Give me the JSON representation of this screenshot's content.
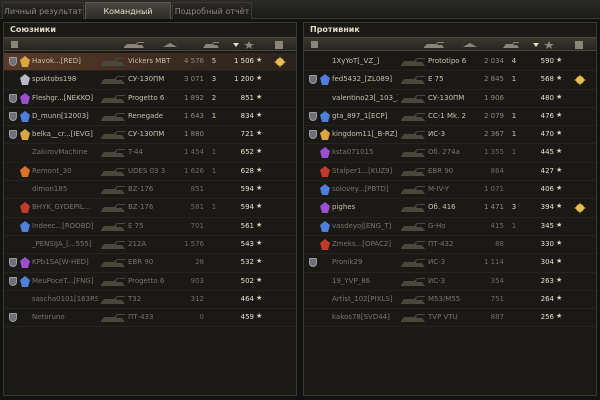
{
  "tabs": [
    {
      "label": "Личный результат",
      "active": false
    },
    {
      "label": "Командный результат",
      "active": true
    },
    {
      "label": "Подробный отчёт",
      "active": false
    }
  ],
  "allies": {
    "title": "Союзники",
    "rows": [
      {
        "name": "Havok...[RED]",
        "vehicle": "Vickers MBT",
        "damage": "4 576",
        "kills": "5",
        "xp": "1 506",
        "self": true,
        "platoon": true,
        "achievement": true,
        "medal": "gold"
      },
      {
        "name": "spsktobs198",
        "vehicle": "СУ-130ПМ",
        "damage": "3 071",
        "kills": "3",
        "xp": "1 200",
        "medal": "silver"
      },
      {
        "name": "Fleshgr...[NEKKO]",
        "vehicle": "Progetto 6",
        "damage": "1 892",
        "kills": "2",
        "xp": "851",
        "platoon": true,
        "medal": "purple"
      },
      {
        "name": "D_munn[12003]",
        "vehicle": "Renegade",
        "damage": "1 643",
        "kills": "1",
        "xp": "834",
        "platoon": true,
        "medal": "blue"
      },
      {
        "name": "belka__cr...[IEVG]",
        "vehicle": "СУ-130ПМ",
        "damage": "1 880",
        "kills": "",
        "xp": "721",
        "platoon": true,
        "medal": "gold"
      },
      {
        "name": "ZakirovMachine",
        "vehicle": "T-44",
        "damage": "1 454",
        "kills": "1",
        "xp": "652",
        "dead": true
      },
      {
        "name": "Remont_30",
        "vehicle": "UDES 03 3",
        "damage": "1 626",
        "kills": "1",
        "xp": "628",
        "dead": true,
        "medal": "orange"
      },
      {
        "name": "dimon185",
        "vehicle": "BZ-176",
        "damage": "851",
        "kills": "",
        "xp": "594",
        "dead": true
      },
      {
        "name": "BHYK_GYDEPIL...",
        "vehicle": "BZ-176",
        "damage": "581",
        "kills": "1",
        "xp": "594",
        "dead": true,
        "medal": "red"
      },
      {
        "name": "Indeec...[ROOBD]",
        "vehicle": "E 75",
        "damage": "701",
        "kills": "",
        "xp": "561",
        "dead": true,
        "medal": "blue"
      },
      {
        "name": "_PENSIJA_[...555]",
        "vehicle": "212A",
        "damage": "1 576",
        "kills": "",
        "xp": "543",
        "dead": true
      },
      {
        "name": "KPb1SA[W-HED]",
        "vehicle": "EBR 90",
        "damage": "28",
        "kills": "",
        "xp": "532",
        "dead": true,
        "platoon": true,
        "medal": "purple"
      },
      {
        "name": "MeuPoceT...[FNG]",
        "vehicle": "Progetto 6",
        "damage": "903",
        "kills": "",
        "xp": "502",
        "dead": true,
        "platoon": true,
        "medal": "blue"
      },
      {
        "name": "sascha0101[163RS]",
        "vehicle": "T32",
        "damage": "312",
        "kills": "",
        "xp": "464",
        "dead": true
      },
      {
        "name": "Netoruno",
        "vehicle": "ПТ-433",
        "damage": "0",
        "kills": "",
        "xp": "459",
        "dead": true,
        "platoon": true
      }
    ]
  },
  "enemies": {
    "title": "Противник",
    "rows": [
      {
        "name": "1XyYoT[_VZ_]",
        "vehicle": "Prototipo 6",
        "damage": "2 034",
        "kills": "4",
        "xp": "590"
      },
      {
        "name": "fed5432_[ZL089]",
        "vehicle": "E 75",
        "damage": "2 845",
        "kills": "1",
        "xp": "568",
        "platoon": true,
        "medal": "blue",
        "achievement": true
      },
      {
        "name": "valentino23[_103_]",
        "vehicle": "СУ-130ПМ",
        "damage": "1 906",
        "kills": "",
        "xp": "480"
      },
      {
        "name": "gta_897_1[ECP]",
        "vehicle": "CC-1 Mk. 2",
        "damage": "2 079",
        "kills": "1",
        "xp": "476",
        "platoon": true,
        "medal": "blue"
      },
      {
        "name": "kingdom11[_B-RZ]",
        "vehicle": "ИС-3",
        "damage": "2 367",
        "kills": "1",
        "xp": "470",
        "platoon": true,
        "medal": "gold"
      },
      {
        "name": "ksta071015",
        "vehicle": "Об. 274а",
        "damage": "1 355",
        "kills": "1",
        "xp": "445",
        "dead": true,
        "medal": "purple"
      },
      {
        "name": "Stalper1...[KUZ9]",
        "vehicle": "EBR 90",
        "damage": "864",
        "kills": "",
        "xp": "427",
        "dead": true,
        "medal": "red"
      },
      {
        "name": "solovey...[PBTD]",
        "vehicle": "M-IV-Y",
        "damage": "1 071",
        "kills": "",
        "xp": "406",
        "dead": true,
        "medal": "blue"
      },
      {
        "name": "pighes",
        "vehicle": "Об. 416",
        "damage": "1 471",
        "kills": "3",
        "xp": "394",
        "medal": "purple",
        "achievement": true
      },
      {
        "name": "vasdeyoj[ENG_T]",
        "vehicle": "G-Ho",
        "damage": "415",
        "kills": "1",
        "xp": "345",
        "dead": true,
        "medal": "blue"
      },
      {
        "name": "Zmeks...[OPAC2]",
        "vehicle": "ПТ-432",
        "damage": "88",
        "kills": "",
        "xp": "330",
        "dead": true,
        "medal": "red"
      },
      {
        "name": "Pronik29",
        "vehicle": "ИС-3",
        "damage": "1 114",
        "kills": "",
        "xp": "304",
        "dead": true,
        "platoon": true
      },
      {
        "name": "19_YVP_86",
        "vehicle": "ИС-3",
        "damage": "354",
        "kills": "",
        "xp": "263",
        "dead": true
      },
      {
        "name": "Artist_102[PIXLS]",
        "vehicle": "M53/M55",
        "damage": "751",
        "kills": "",
        "xp": "264",
        "dead": true
      },
      {
        "name": "kakos78[SVD44]",
        "vehicle": "TVP VTU",
        "damage": "887",
        "kills": "",
        "xp": "256",
        "dead": true
      }
    ]
  },
  "colors": {
    "gold": "#d9a640",
    "silver": "#b8b8c8",
    "purple": "#9a4fd0",
    "blue": "#4f7fd9",
    "orange": "#d9732b",
    "red": "#c0392b"
  }
}
